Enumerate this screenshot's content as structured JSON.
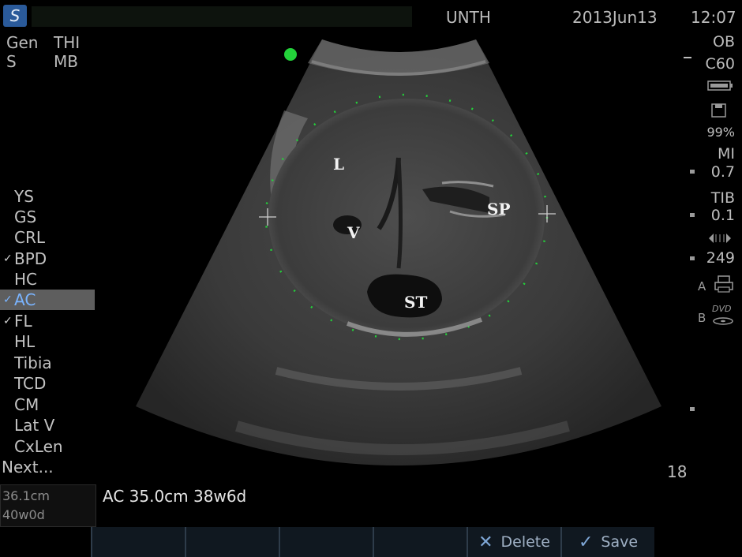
{
  "header": {
    "logo_glyph": "S",
    "center_text": "UNTH",
    "date": "2013Jun13",
    "time": "12:07"
  },
  "top_left": {
    "row1_left": "Gen",
    "row1_right": "THI",
    "row2_left": "S",
    "row2_right": "MB"
  },
  "menu": {
    "items": [
      {
        "label": "YS",
        "checked": false
      },
      {
        "label": "GS",
        "checked": false
      },
      {
        "label": "CRL",
        "checked": false
      },
      {
        "label": "BPD",
        "checked": true
      },
      {
        "label": "HC",
        "checked": false
      },
      {
        "label": "AC",
        "checked": true,
        "selected": true
      },
      {
        "label": "FL",
        "checked": true
      },
      {
        "label": "HL",
        "checked": false
      },
      {
        "label": "Tibia",
        "checked": false
      },
      {
        "label": "TCD",
        "checked": false
      },
      {
        "label": "CM",
        "checked": false
      },
      {
        "label": "Lat V",
        "checked": false
      },
      {
        "label": "CxLen",
        "checked": false
      }
    ],
    "check_glyph": "✓",
    "next_label": "Next..."
  },
  "result": {
    "line1": "36.1cm",
    "line2": "40w0d"
  },
  "right_panel": {
    "exam": "OB",
    "probe": "C60",
    "percent": "99%",
    "mi_label": "MI",
    "mi_value": "0.7",
    "tib_label": "TIB",
    "tib_value": "0.1",
    "frame_value": "249",
    "a_label": "A",
    "b_label": "B"
  },
  "image": {
    "labels": {
      "liver": "L",
      "vein": "V",
      "spine": "SP",
      "stomach": "ST"
    },
    "accent_green": "#23d33a"
  },
  "measurement": {
    "text": "AC 35.0cm 38w6d"
  },
  "depth": "18",
  "softkeys": {
    "delete_label": "Delete",
    "save_label": "Save",
    "delete_icon": "✕",
    "save_icon": "✓"
  }
}
